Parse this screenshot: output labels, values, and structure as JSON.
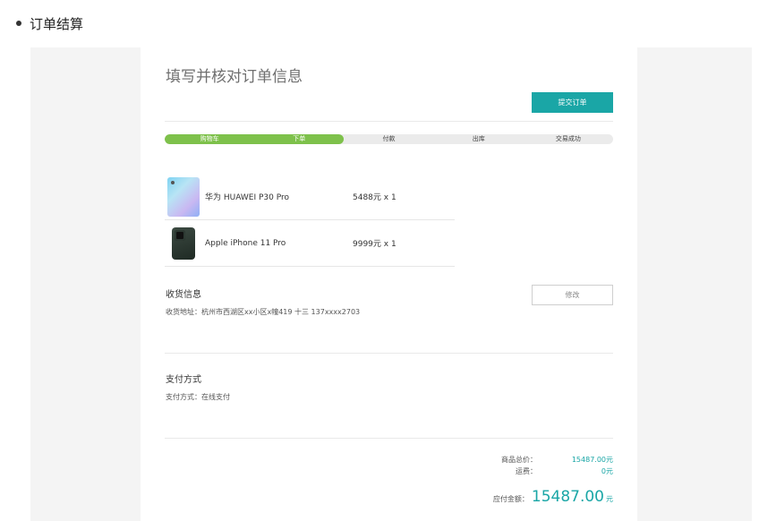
{
  "heading": "订单结算",
  "checkout": {
    "title": "填写并核对订单信息",
    "submit_label": "提交订单",
    "steps": [
      {
        "label": "购物车",
        "done": true
      },
      {
        "label": "下单",
        "done": true
      },
      {
        "label": "付款",
        "done": false
      },
      {
        "label": "出库",
        "done": false
      },
      {
        "label": "交易成功",
        "done": false
      }
    ],
    "progress_fraction": 0.4,
    "products": [
      {
        "name": "华为 HUAWEI P30 Pro",
        "price": "5488元 x 1",
        "image": "huawei-p30-pro-image"
      },
      {
        "name": "Apple iPhone 11 Pro",
        "price": "9999元 x 1",
        "image": "iphone-11-pro-image"
      }
    ],
    "shipping": {
      "title": "收货信息",
      "address": "收货地址：杭州市西湖区xx小区x幢419 十三 137xxxx2703",
      "modify_label": "修改"
    },
    "payment": {
      "title": "支付方式",
      "method": "支付方式：在线支付"
    },
    "summary": {
      "goods_total_label": "商品总价：",
      "goods_total_value": "15487.00元",
      "shipping_label": "运费：",
      "shipping_value": "0元",
      "payable_label": "应付金额：",
      "payable_amount": "15487.00",
      "payable_unit": "元"
    }
  },
  "colors": {
    "accent": "#1aa6a6",
    "progress_green": "#7ec14b",
    "background_frame": "#f4f4f4"
  }
}
